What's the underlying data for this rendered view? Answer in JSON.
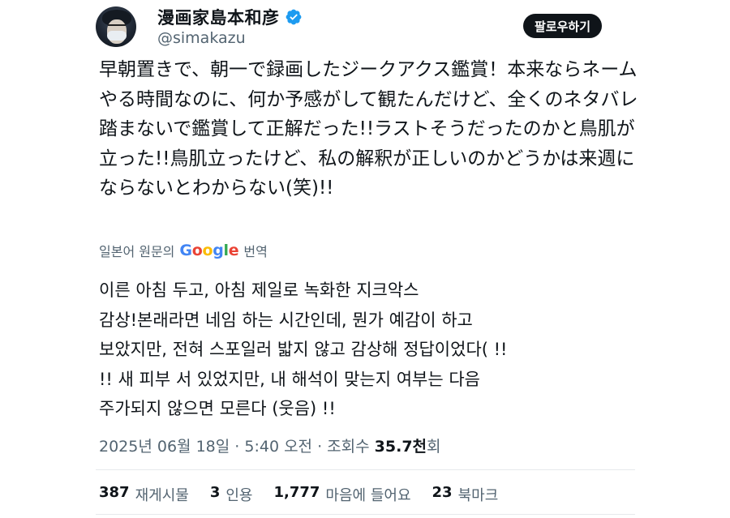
{
  "user": {
    "display_name": "漫画家島本和彦",
    "handle": "@simakazu",
    "verified_color": "#1d9bf0"
  },
  "follow_button": {
    "label": "팔로우하기"
  },
  "tweet": {
    "text": "早朝置きで、朝一で録画したジークアクス鑑賞！本来ならネームやる時間なのに、何か予感がして観たんだけど、全くのネタバレ踏まないで鑑賞して正解だった!!ラストそうだったのかと鳥肌が立った!!鳥肌立ったけど、私の解釈が正しいのかどうかは来週にならないとわからない(笑)!!"
  },
  "translation": {
    "prefix": "일본어 원문의",
    "service": "Google",
    "suffix": "번역",
    "text": "이른 아침 두고, 아침 제일로 녹화한 지크악스\n감상!본래라면 네임 하는 시간인데, 뭔가 예감이 하고\n보았지만, 전혀 스포일러 밟지 않고 감상해 정답이었다( !!\n!! 새 피부 서 있었지만, 내 해석이 맞는지 여부는 다음\n주가되지 않으면 모른다 (웃음) !!"
  },
  "meta": {
    "date": "2025년 06월 18일",
    "separator": " · ",
    "time": "5:40 오전",
    "views_label": "조회수",
    "views_count": "35.7천",
    "views_suffix": "회"
  },
  "stats": [
    {
      "count": "387",
      "label": "재게시물"
    },
    {
      "count": "3",
      "label": "인용"
    },
    {
      "count": "1,777",
      "label": "마음에 들어요"
    },
    {
      "count": "23",
      "label": "북마크"
    }
  ]
}
